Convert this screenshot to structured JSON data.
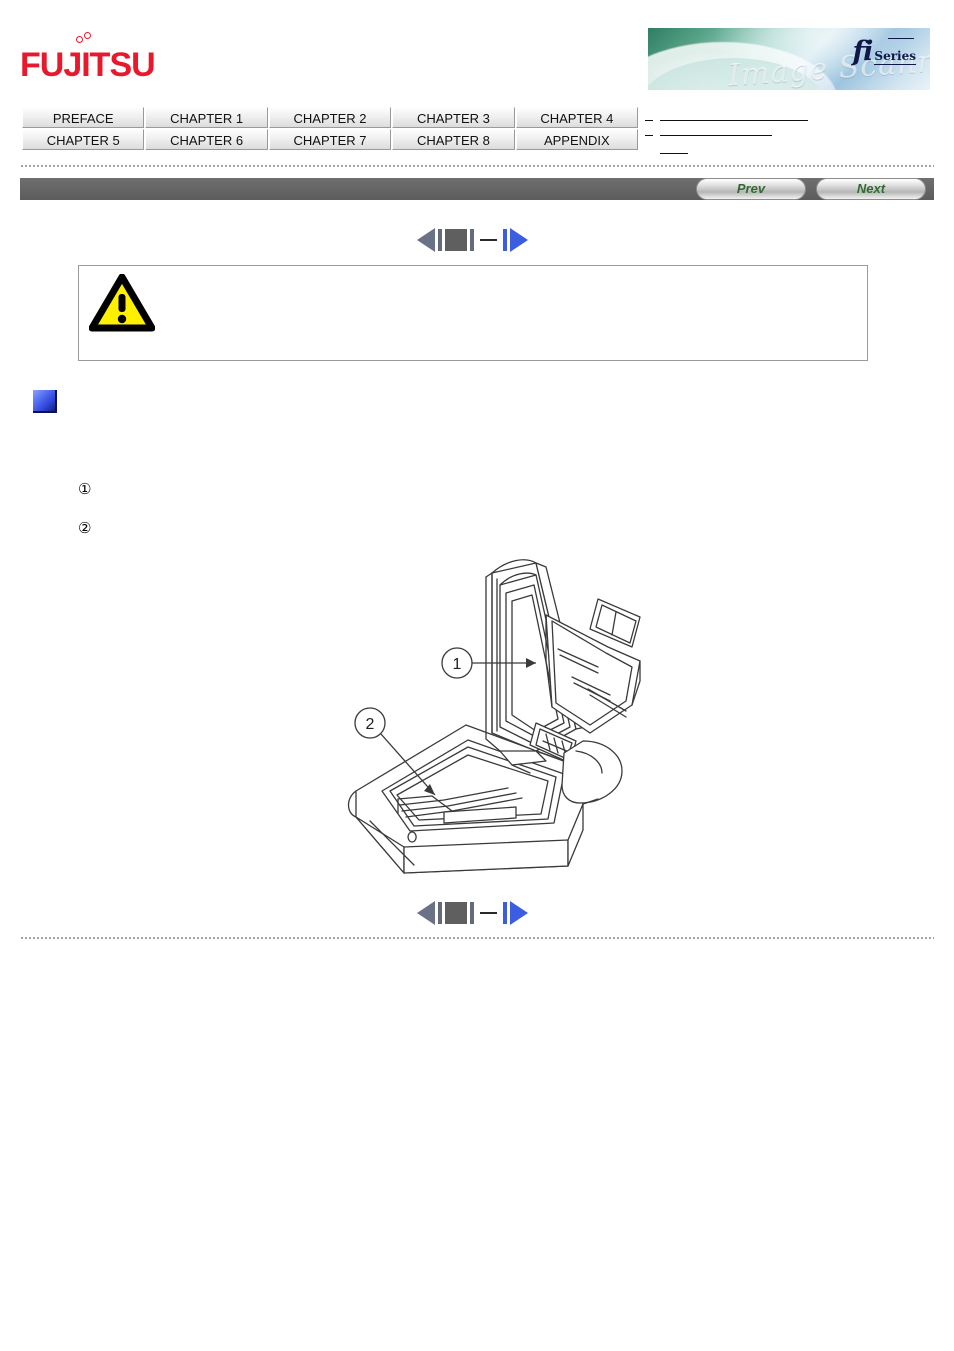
{
  "header": {
    "logo_text": "FUJITSU",
    "logo_color": "#e8192c",
    "banner": {
      "fi_text": "fi",
      "series_text": "Series",
      "script_text": "Image Scanner"
    }
  },
  "tabs": {
    "row1": [
      {
        "label": "PREFACE",
        "name": "tab-preface"
      },
      {
        "label": "CHAPTER 1",
        "name": "tab-chapter-1"
      },
      {
        "label": "CHAPTER 2",
        "name": "tab-chapter-2"
      },
      {
        "label": "CHAPTER 3",
        "name": "tab-chapter-3"
      },
      {
        "label": "CHAPTER 4",
        "name": "tab-chapter-4"
      }
    ],
    "row2": [
      {
        "label": "CHAPTER 5",
        "name": "tab-chapter-5"
      },
      {
        "label": "CHAPTER 6",
        "name": "tab-chapter-6"
      },
      {
        "label": "CHAPTER 7",
        "name": "tab-chapter-7"
      },
      {
        "label": "CHAPTER 8",
        "name": "tab-chapter-8"
      },
      {
        "label": "APPENDIX",
        "name": "tab-appendix"
      }
    ]
  },
  "navbar": {
    "prev_label": "Prev",
    "next_label": "Next",
    "bar_color": "#666666",
    "button_text_color": "#2f6b2f"
  },
  "pagenav": {
    "prev_arrow": "left-triangle",
    "next_arrow": "right-triangle",
    "next_arrow_color": "#3b5de0",
    "prev_arrow_color": "#6b7288"
  },
  "caution": {
    "icon": "warning-triangle-icon",
    "icon_fill": "#fff000",
    "text": ""
  },
  "section": {
    "bullet_color": "#2c42d8",
    "title": "",
    "intro": "",
    "steps": [
      {
        "marker": "①",
        "text": ""
      },
      {
        "marker": "②",
        "text": ""
      }
    ]
  },
  "figure": {
    "alt": "fi Series flatbed image scanner with document cover raised",
    "callouts": [
      {
        "number": "1",
        "points_to": "document-cover"
      },
      {
        "number": "2",
        "points_to": "document-bed-glass"
      }
    ]
  }
}
